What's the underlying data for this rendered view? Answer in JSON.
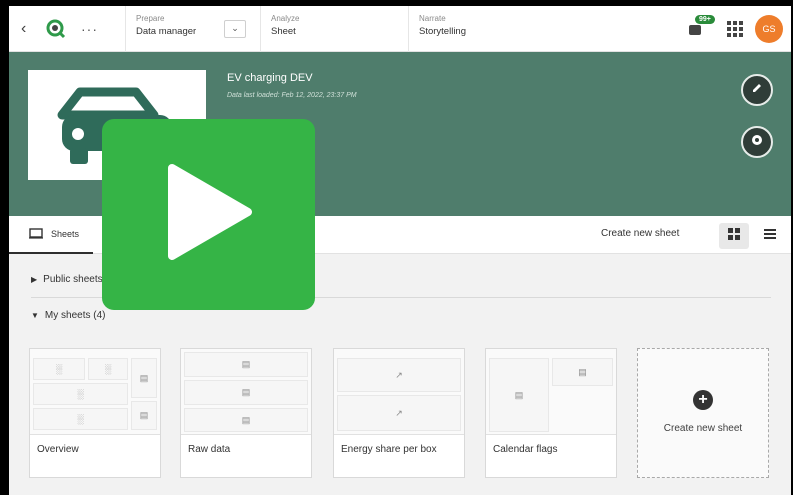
{
  "nav": {
    "back_icon": "chevron-left-icon",
    "logo_icon": "qlik-logo-icon",
    "more_label": "···",
    "prepare": {
      "small": "Prepare",
      "big": "Data manager"
    },
    "analyze": {
      "small": "Analyze",
      "big": "Sheet"
    },
    "narrate": {
      "small": "Narrate",
      "big": "Storytelling"
    },
    "notifications_badge": "99+",
    "avatar_initials": "GS",
    "avatar_color": "#ee7d2b"
  },
  "app": {
    "title": "EV charging DEV",
    "subtitle": "Data last loaded: Feb 12, 2022, 23:37 PM",
    "band_color": "#4f7d6c"
  },
  "tabs": {
    "sheets_label": "Sheets",
    "create_new_sheet": "Create new sheet"
  },
  "sections": {
    "public": "Public sheets",
    "mine": "My sheets (4)"
  },
  "sheets": [
    {
      "title": "Overview"
    },
    {
      "title": "Raw data"
    },
    {
      "title": "Energy share per box"
    },
    {
      "title": "Calendar flags"
    }
  ],
  "new_sheet_card": {
    "label": "Create new sheet"
  },
  "play_color": "#35b446"
}
